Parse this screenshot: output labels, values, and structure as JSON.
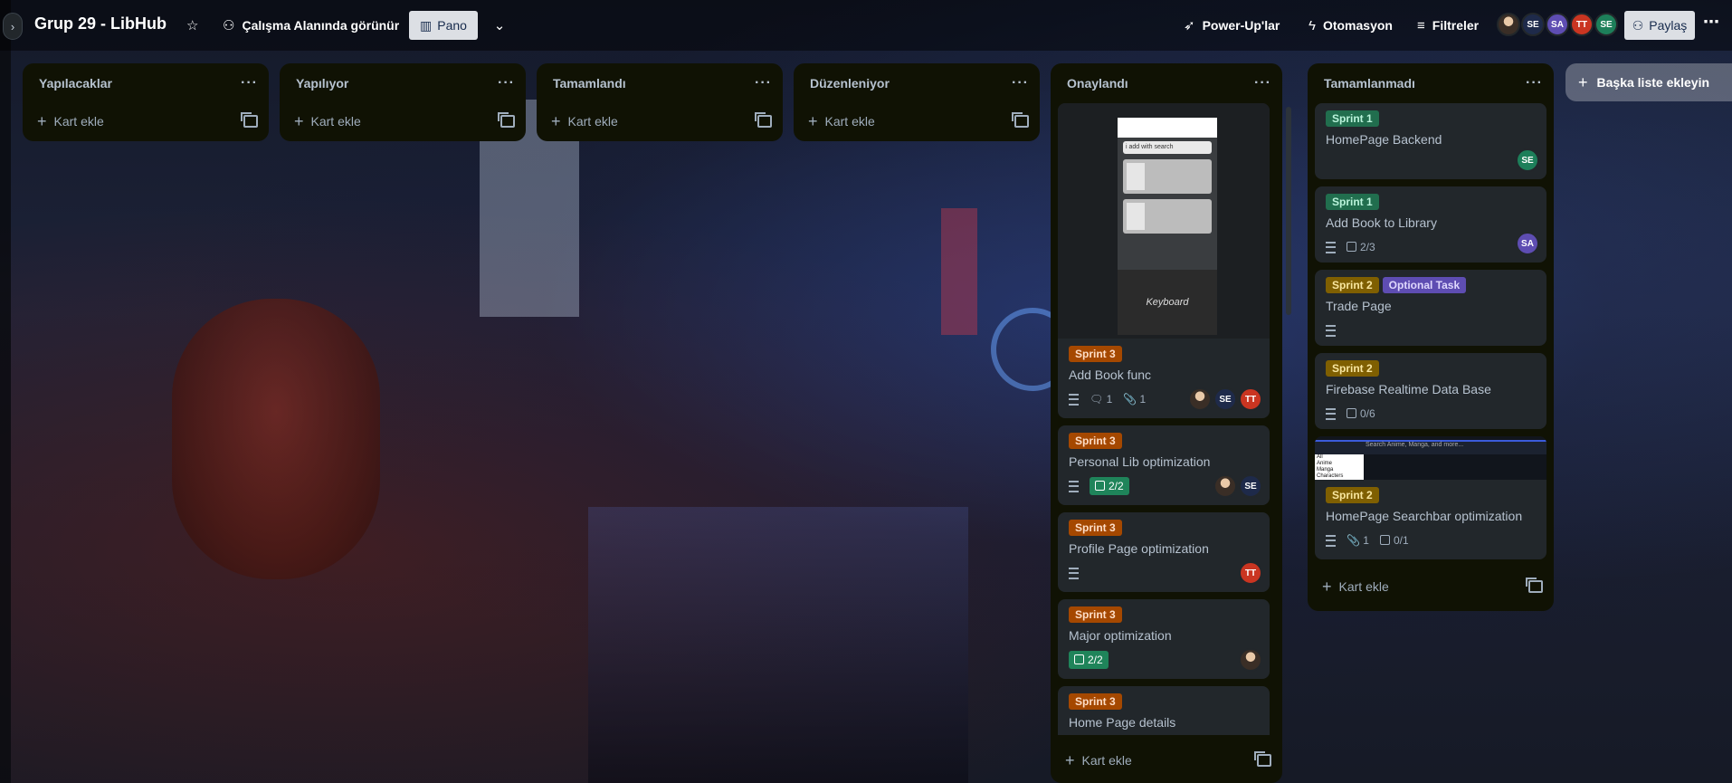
{
  "board": {
    "title": "Grup 29 - LibHub",
    "visibility_label": "Çalışma Alanında görünür",
    "view_label": "Pano",
    "powerups_label": "Power-Up'lar",
    "automation_label": "Otomasyon",
    "filters_label": "Filtreler",
    "share_label": "Paylaş",
    "members": [
      "SE",
      "SA",
      "TT",
      "SE"
    ]
  },
  "add_card_label": "Kart ekle",
  "add_list_label": "Başka liste ekleyin",
  "lists": [
    {
      "title": "Yapılacaklar"
    },
    {
      "title": "Yapılıyor"
    },
    {
      "title": "Tamamlandı"
    },
    {
      "title": "Düzenleniyor"
    },
    {
      "title": "Onaylandı",
      "cover": {
        "search_text": "i add with search",
        "keyboard_text": "Keyboard"
      },
      "cards": [
        {
          "label": "Sprint 3",
          "title": "Add Book func",
          "comments": "1",
          "attachments": "1",
          "members": [
            "SE",
            "TT"
          ]
        },
        {
          "label": "Sprint 3",
          "title": "Personal Lib optimization",
          "checklist": "2/2",
          "members": [
            "SE"
          ]
        },
        {
          "label": "Sprint 3",
          "title": "Profile Page optimization",
          "members": [
            "TT"
          ]
        },
        {
          "label": "Sprint 3",
          "title": "Major optimization",
          "checklist": "2/2"
        },
        {
          "label": "Sprint 3",
          "title": "Home Page details"
        }
      ]
    },
    {
      "title": "Tamamlanmadı",
      "cards": [
        {
          "label": "Sprint 1",
          "title": "HomePage Backend",
          "members": [
            "SE"
          ]
        },
        {
          "label": "Sprint 1",
          "title": "Add Book to Library",
          "checklist": "2/3",
          "members": [
            "SA"
          ]
        },
        {
          "label": "Sprint 2",
          "label2": "Optional Task",
          "title": "Trade Page"
        },
        {
          "label": "Sprint 2",
          "title": "Firebase Realtime Data Base",
          "checklist": "0/6"
        },
        {
          "label": "Sprint 2",
          "title": "HomePage Searchbar optimization",
          "attachments": "1",
          "checklist": "0/1",
          "cover": {
            "select": "All",
            "options": [
              "All",
              "Anime",
              "Manga",
              "Characters"
            ],
            "placeholder": "Search Anime, Manga, and more..."
          }
        }
      ]
    }
  ]
}
